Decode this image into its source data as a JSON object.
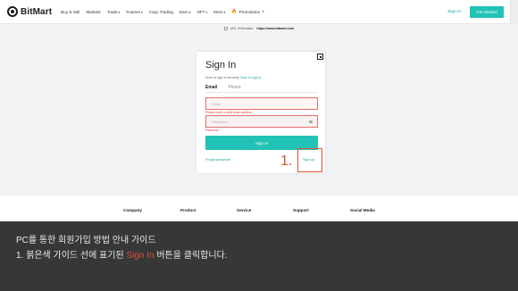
{
  "header": {
    "logo": "BitMart",
    "nav": [
      {
        "label": "Buy & Sell",
        "caret": false
      },
      {
        "label": "Markets",
        "caret": false
      },
      {
        "label": "Trade",
        "caret": true
      },
      {
        "label": "Futures",
        "caret": true
      },
      {
        "label": "Copy Trading",
        "caret": false
      },
      {
        "label": "Earn",
        "caret": true
      },
      {
        "label": "NFT",
        "caret": true
      },
      {
        "label": "More",
        "caret": true
      }
    ],
    "promotions": "Promotions",
    "signin": "Sign In",
    "start": "Get Started"
  },
  "notice": {
    "label": "URL Verification:",
    "url": "https://www.bitmart.com"
  },
  "card": {
    "title": "Sign In",
    "subtitle": "Scan to sign in securely",
    "subtitle_link": "Scan to sign in",
    "tabs": [
      "Email",
      "Phone"
    ],
    "email_placeholder": "Email",
    "email_error": "Please enter a valid email address",
    "password_placeholder": "Password",
    "password_error": "Password",
    "signin_button": "Sign In",
    "forgot": "Forgot password",
    "signup": "Sign Up"
  },
  "guide": {
    "number": "1."
  },
  "footer": {
    "columns": [
      "Company",
      "Product",
      "Service",
      "Support",
      "Social Media"
    ]
  },
  "overlay": {
    "line1": "PC를 통한 회원가입 방법 안내 가이드",
    "line2_prefix": "1. 붉은색 가이드 선에 표기된 ",
    "line2_highlight": "Sign In",
    "line2_suffix": " 버튼을 클릭합니다."
  },
  "colors": {
    "accent": "#22c2b6",
    "guide_red": "#e0502f",
    "error_red": "#e03b3b"
  }
}
